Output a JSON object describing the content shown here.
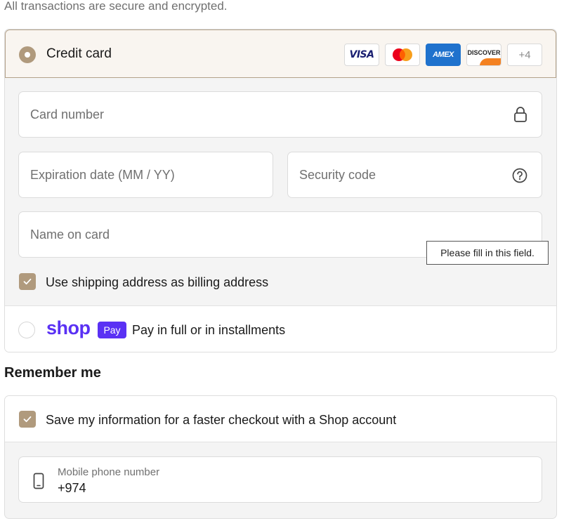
{
  "secure_note": "All transactions are secure and encrypted.",
  "payment": {
    "credit_card": {
      "label": "Credit card",
      "selected": true,
      "brands": [
        {
          "name": "VISA",
          "icon": "visa-icon"
        },
        {
          "name": "Mastercard",
          "icon": "mastercard-icon"
        },
        {
          "name": "AMEX",
          "icon": "amex-icon"
        },
        {
          "name": "DISCOVER",
          "icon": "discover-icon"
        }
      ],
      "more_brands": "+4",
      "card_number_placeholder": "Card number",
      "expiration_placeholder": "Expiration date (MM / YY)",
      "security_code_placeholder": "Security code",
      "name_on_card_placeholder": "Name on card",
      "validation_tooltip": "Please fill in this field.",
      "billing_checkbox_label": "Use shipping address as billing address",
      "billing_checked": true
    },
    "shop_pay": {
      "logo_text": "shop",
      "badge_text": "Pay",
      "label": "Pay in full or in installments",
      "selected": false
    }
  },
  "remember_me": {
    "title": "Remember me",
    "save_label": "Save my information for a faster checkout with a Shop account",
    "save_checked": true,
    "phone_label": "Mobile phone number",
    "phone_value": "+974"
  },
  "colors": {
    "accent": "#b09a7d",
    "header_bg": "#f9f5f0",
    "shop_purple": "#5a31f4"
  }
}
